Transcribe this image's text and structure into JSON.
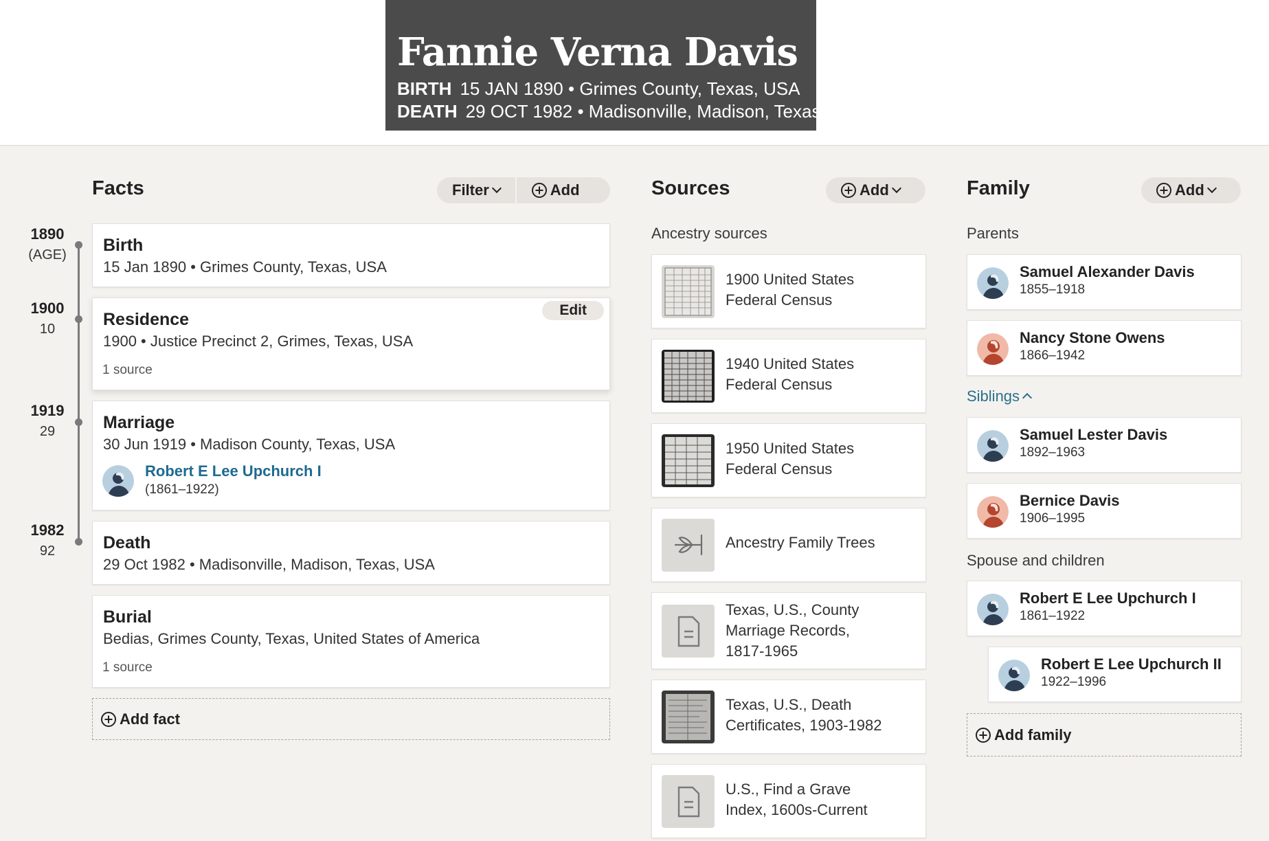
{
  "person": {
    "name": "Fannie Verna Davis",
    "birth_label": "BIRTH",
    "birth_value": "15 JAN 1890 • Grimes County, Texas, USA",
    "death_label": "DEATH",
    "death_value": "29 OCT 1982 • Madisonville, Madison, Texas,"
  },
  "facts": {
    "heading": "Facts",
    "filter_label": "Filter",
    "add_label": "Add",
    "add_fact_label": "Add fact",
    "timeline": [
      {
        "year": "1890",
        "age": "(AGE)"
      },
      {
        "year": "1900",
        "age": "10"
      },
      {
        "year": "1919",
        "age": "29"
      },
      {
        "year": "1982",
        "age": "92"
      }
    ],
    "items": [
      {
        "title": "Birth",
        "detail": "15 Jan 1890 • Grimes County, Texas, USA"
      },
      {
        "title": "Residence",
        "detail": "1900 • Justice Precinct 2, Grimes, Texas, USA",
        "sources": "1 source",
        "edit_label": "Edit"
      },
      {
        "title": "Marriage",
        "detail": "30 Jun 1919 • Madison County, Texas, USA",
        "spouse_name": "Robert E Lee Upchurch I",
        "spouse_years": "(1861–1922)"
      },
      {
        "title": "Death",
        "detail": "29 Oct 1982 • Madisonville, Madison, Texas, USA"
      },
      {
        "title": "Burial",
        "detail": "Bedias, Grimes County, Texas, United States of America",
        "sources": "1 source"
      }
    ]
  },
  "sources": {
    "heading": "Sources",
    "add_label": "Add",
    "subheading": "Ancestry sources",
    "items": [
      {
        "title": "1900 United States Federal Census",
        "icon": "census-thumbnail"
      },
      {
        "title": "1940 United States Federal Census",
        "icon": "census-thumbnail"
      },
      {
        "title": "1950 United States Federal Census",
        "icon": "census-thumbnail"
      },
      {
        "title": "Ancestry Family Trees",
        "icon": "leaf-tree-icon"
      },
      {
        "title": "Texas, U.S., County Marriage Records, 1817-1965",
        "icon": "document-icon"
      },
      {
        "title": "Texas, U.S., Death Certificates, 1903-1982",
        "icon": "certificate-thumbnail"
      },
      {
        "title": "U.S., Find a Grave Index, 1600s-Current",
        "icon": "document-icon"
      }
    ]
  },
  "family": {
    "heading": "Family",
    "add_label": "Add",
    "parents_label": "Parents",
    "siblings_label": "Siblings",
    "spouse_children_label": "Spouse and children",
    "add_family_label": "Add family",
    "parents": [
      {
        "name": "Samuel Alexander Davis",
        "years": "1855–1918",
        "gender": "male"
      },
      {
        "name": "Nancy Stone Owens",
        "years": "1866–1942",
        "gender": "female"
      }
    ],
    "siblings": [
      {
        "name": "Samuel Lester Davis",
        "years": "1892–1963",
        "gender": "male"
      },
      {
        "name": "Bernice Davis",
        "years": "1906–1995",
        "gender": "female"
      }
    ],
    "spouse": {
      "name": "Robert E Lee Upchurch I",
      "years": "1861–1922",
      "gender": "male"
    },
    "children": [
      {
        "name": "Robert E Lee Upchurch II",
        "years": "1922–1996",
        "gender": "male"
      }
    ]
  },
  "colors": {
    "header_bg": "#4b4b4b",
    "page_bg": "#f4f2ef",
    "link": "#1e6a8f",
    "male_avatar": "#b8cfe0",
    "female_avatar": "#f0b9a8"
  }
}
